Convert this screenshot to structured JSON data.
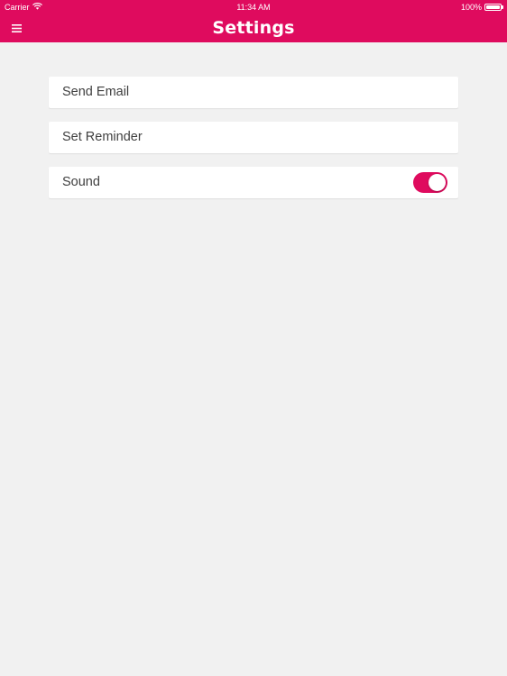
{
  "status_bar": {
    "carrier": "Carrier",
    "time": "11:34 AM",
    "battery_percent": "100%",
    "battery_level": 1.0,
    "wifi_icon": "wifi-icon"
  },
  "header": {
    "title": "Settings",
    "menu_icon": "menu-icon"
  },
  "settings": {
    "items": [
      {
        "label": "Send Email"
      },
      {
        "label": "Set Reminder"
      },
      {
        "label": "Sound",
        "toggle_on": true
      }
    ]
  },
  "colors": {
    "accent": "#df0b5e",
    "background": "#f1f1f1",
    "row_background": "#ffffff",
    "text": "#3f3f3f"
  }
}
